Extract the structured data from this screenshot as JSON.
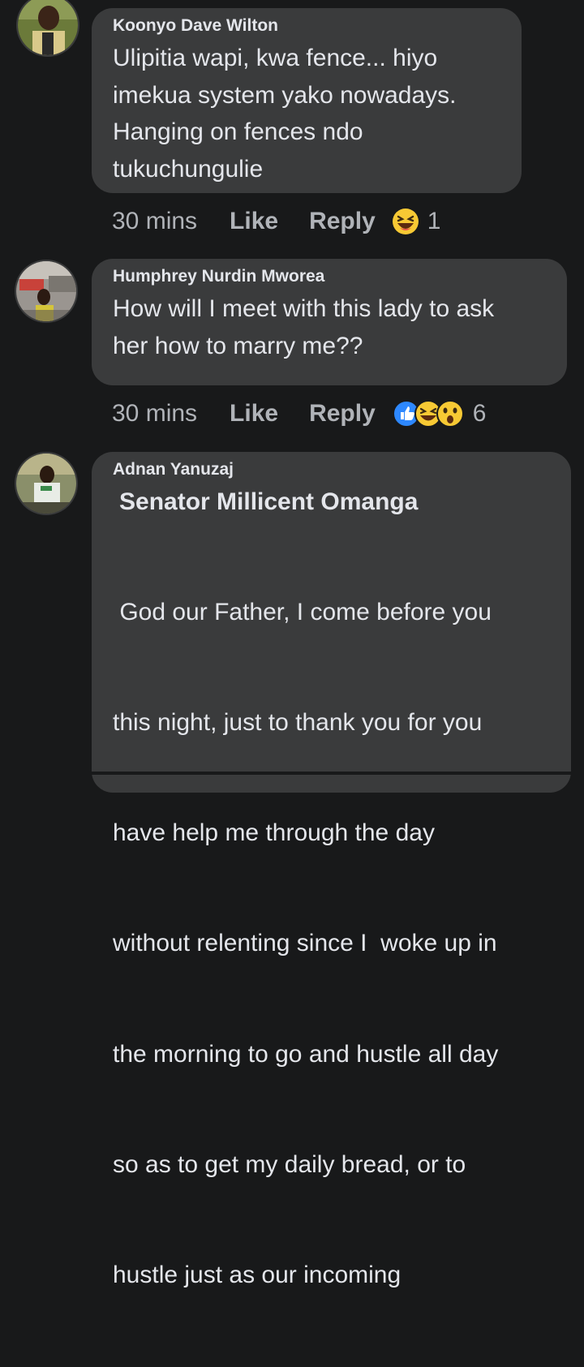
{
  "comments": [
    {
      "author": "Koonyo Dave Wilton",
      "lines": [
        "Ulipitia wapi, kwa fence... hiyo",
        "imekua system yako nowadays.",
        "Hanging on fences ndo",
        "tukuchungulie"
      ],
      "time": "30 mins",
      "like_label": "Like",
      "reply_label": "Reply",
      "reactions": [
        "laughing-emoji"
      ],
      "reaction_count": "1"
    },
    {
      "author": "Humphrey Nurdin Mworea",
      "lines": [
        "How will I meet with this lady to ask",
        "her how to marry me??"
      ],
      "time": "30 mins",
      "like_label": "Like",
      "reply_label": "Reply",
      "reactions": [
        "like-icon",
        "laughing-emoji",
        "wow-emoji"
      ],
      "reaction_count": "6"
    },
    {
      "author": "Adnan Yanuzaj",
      "mention": "Senator Millicent Omanga",
      "lines": [
        " God our Father, I come before you",
        "this night, just to thank you for you",
        "have help me through the day",
        "without relenting since I  woke up in",
        "the morning to go and hustle all day",
        "so as to get my daily bread, or to",
        "hustle just as our incoming"
      ]
    }
  ],
  "colors": {
    "background": "#18191a",
    "bubble": "#3a3b3c",
    "text": "#e4e6eb",
    "meta": "#b0b3b8",
    "like_blue": "#2d88ff",
    "emoji_yellow": "#f7c934"
  }
}
